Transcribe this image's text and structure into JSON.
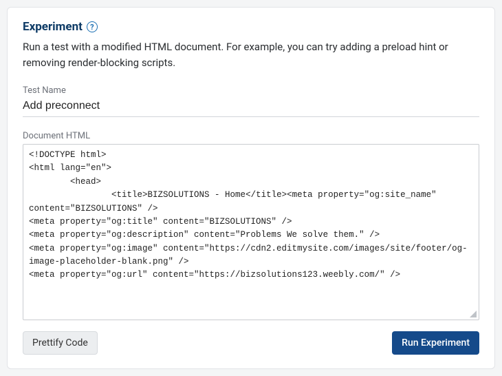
{
  "header": {
    "title": "Experiment",
    "help_glyph": "?"
  },
  "description": "Run a test with a modified HTML document. For example, you can try adding a preload hint or removing render-blocking scripts.",
  "fields": {
    "test_name": {
      "label": "Test Name",
      "value": "Add preconnect"
    },
    "document_html": {
      "label": "Document HTML",
      "value": "<!DOCTYPE html>\n<html lang=\"en\">\n        <head>\n                <title>BIZSOLUTIONS - Home</title><meta property=\"og:site_name\" content=\"BIZSOLUTIONS\" />\n<meta property=\"og:title\" content=\"BIZSOLUTIONS\" />\n<meta property=\"og:description\" content=\"Problems We solve them.\" />\n<meta property=\"og:image\" content=\"https://cdn2.editmysite.com/images/site/footer/og-image-placeholder-blank.png\" />\n<meta property=\"og:url\" content=\"https://bizsolutions123.weebly.com/\" />\n"
    }
  },
  "buttons": {
    "prettify": "Prettify Code",
    "run": "Run Experiment"
  }
}
